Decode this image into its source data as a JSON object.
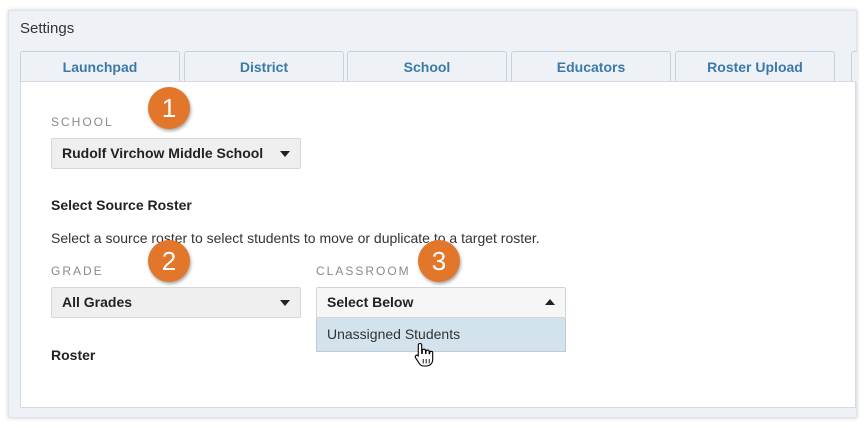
{
  "header": {
    "title": "Settings"
  },
  "tabs": [
    {
      "label": "Launchpad"
    },
    {
      "label": "District"
    },
    {
      "label": "School"
    },
    {
      "label": "Educators"
    },
    {
      "label": "Roster Upload"
    }
  ],
  "school_section": {
    "label": "SCHOOL",
    "selected": "Rudolf Virchow Middle School"
  },
  "source_roster": {
    "heading": "Select Source Roster",
    "description": "Select a source roster to select students to move or duplicate to a target roster.",
    "grade": {
      "label": "GRADE",
      "selected": "All Grades"
    },
    "classroom": {
      "label": "CLASSROOM",
      "selected": "Select Below",
      "options": [
        "Unassigned Students"
      ]
    }
  },
  "roster": {
    "heading": "Roster"
  },
  "callouts": [
    "1",
    "2",
    "3"
  ],
  "colors": {
    "accent": "#e2762a",
    "tab_text": "#3c79a8",
    "highlight_option": "#d3e3ed"
  }
}
